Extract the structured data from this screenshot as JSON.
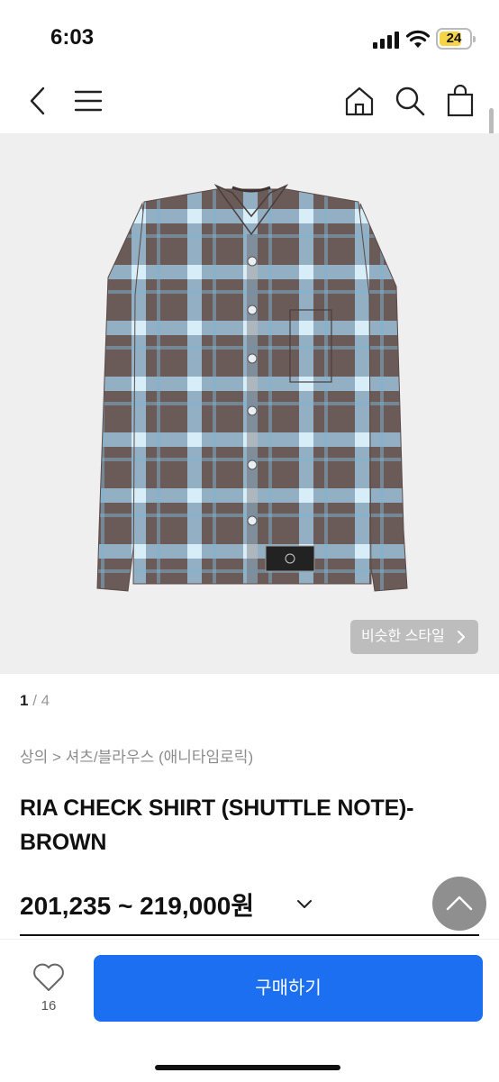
{
  "status_bar": {
    "time": "6:03",
    "battery": "24"
  },
  "nav": {
    "back_icon": "chevron-left-icon",
    "menu_icon": "hamburger-icon",
    "home_icon": "home-icon",
    "search_icon": "search-icon",
    "cart_icon": "shopping-bag-icon"
  },
  "hero": {
    "similar_style_label": "비슷한 스타일",
    "pager_current": "1",
    "pager_total": " / 4"
  },
  "product": {
    "breadcrumb": "상의 > 셔츠/블라우스 (애니타임로릭)",
    "title": "RIA CHECK SHIRT (SHUTTLE NOTE)-BROWN",
    "price": "201,235 ~ 219,000원"
  },
  "bottom_bar": {
    "like_count": "16",
    "buy_label": "구매하기"
  },
  "colors": {
    "accent": "#1b6ff0",
    "hero_bg": "#efefef",
    "shirt_base": "#6a5a58",
    "shirt_check": "#9fcbe6"
  }
}
